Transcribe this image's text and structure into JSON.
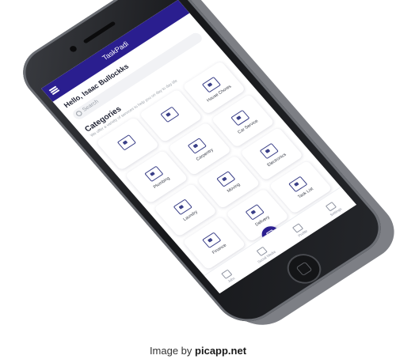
{
  "app": {
    "title": "TaskPadi"
  },
  "greeting": "Hello, Isaac Bullockks",
  "search": {
    "placeholder": "Search"
  },
  "categories": {
    "title": "Categories",
    "subtitle": "We offer a variety of services to help you on day to day life"
  },
  "tiles": [
    {
      "label": "",
      "icon": "blank-icon"
    },
    {
      "label": "",
      "icon": "blank-icon"
    },
    {
      "label": "House Chores",
      "icon": "house-icon"
    },
    {
      "label": "Plumbing",
      "icon": "wrench-icon"
    },
    {
      "label": "Carpentry",
      "icon": "hammer-icon"
    },
    {
      "label": "Car Service",
      "icon": "car-icon"
    },
    {
      "label": "Laundry",
      "icon": "washing-machine-icon"
    },
    {
      "label": "Moving",
      "icon": "truck-icon"
    },
    {
      "label": "Electronics",
      "icon": "device-icon"
    },
    {
      "label": "Finance",
      "icon": "money-icon"
    },
    {
      "label": "Delivery",
      "icon": "delivery-icon"
    },
    {
      "label": "Task List",
      "icon": "list-icon"
    }
  ],
  "tabbar": {
    "items": [
      {
        "label": "Jobs",
        "icon": "jobs-icon"
      },
      {
        "label": "Social Media",
        "icon": "social-icon"
      },
      {
        "label": "Profile",
        "icon": "profile-icon"
      },
      {
        "label": "Settings",
        "icon": "gear-icon"
      }
    ]
  },
  "caption": {
    "prefix": "Image by ",
    "brand": "picapp.net"
  },
  "colors": {
    "accent": "#2a1e8f",
    "phone": "#1c1d20"
  }
}
